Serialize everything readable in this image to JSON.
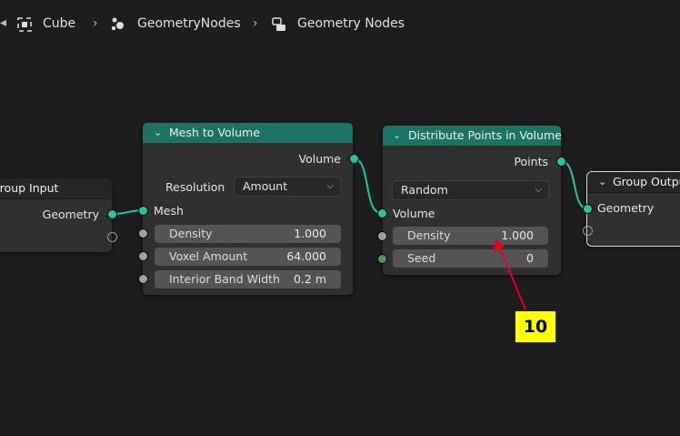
{
  "breadcrumb": {
    "object": "Cube",
    "modifier": "GeometryNodes",
    "node_tree": "Geometry Nodes"
  },
  "nodes": {
    "group_input": {
      "title": "Group Input",
      "output_geometry": "Geometry"
    },
    "mesh_to_volume": {
      "title": "Mesh to Volume",
      "output_volume": "Volume",
      "resolution_label": "Resolution",
      "resolution_value": "Amount",
      "input_mesh": "Mesh",
      "fields": [
        {
          "label": "Density",
          "value": "1.000"
        },
        {
          "label": "Voxel Amount",
          "value": "64.000"
        },
        {
          "label": "Interior Band Width",
          "value": "0.2 m"
        }
      ]
    },
    "distribute_points": {
      "title": "Distribute Points in Volume",
      "output_points": "Points",
      "mode_value": "Random",
      "input_volume": "Volume",
      "fields": [
        {
          "label": "Density",
          "value": "1.000"
        },
        {
          "label": "Seed",
          "value": "0"
        }
      ]
    },
    "group_output": {
      "title": "Group Output",
      "input_geometry": "Geometry"
    }
  },
  "annotation": {
    "label": "10",
    "color": "#ffff00",
    "arrow_color": "#e8001c"
  },
  "colors": {
    "background": "#1d1d1d",
    "node_header_green": "#1d7362",
    "socket_geometry": "#22c7a0",
    "wire": "#22c7a0"
  }
}
